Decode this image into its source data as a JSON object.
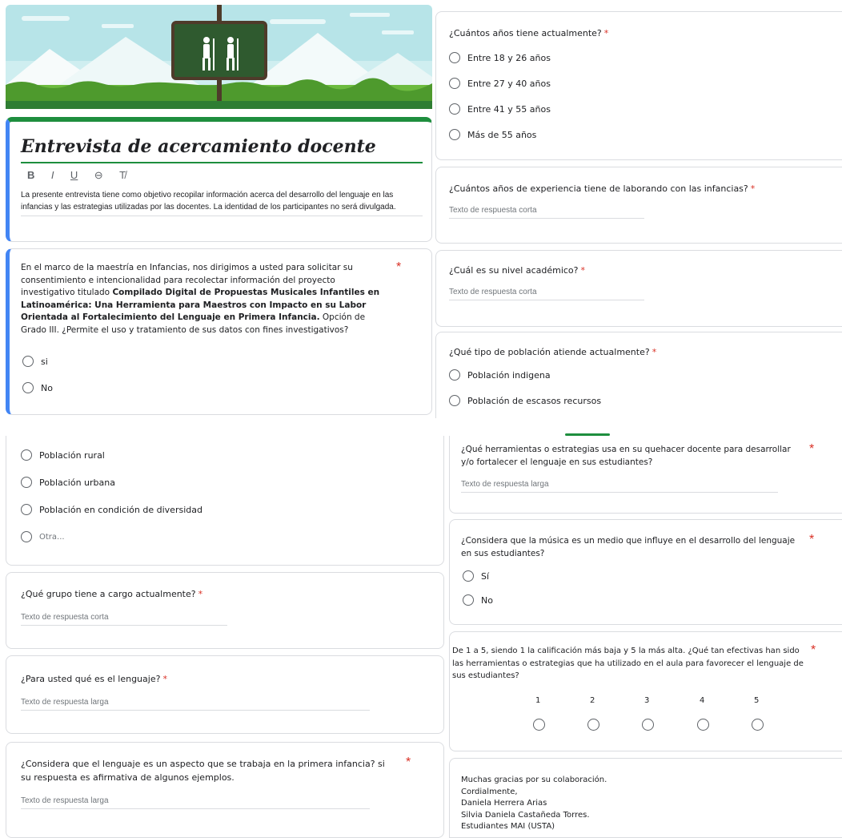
{
  "form": {
    "title": "Entrevista de acercamiento docente",
    "toolbar": {
      "bold": "B",
      "italic": "I",
      "underline": "U",
      "link": "⊖",
      "clear": "T̸"
    },
    "description": "La presente entrevista tiene como objetivo recopilar información acerca del desarrollo del lenguaje en las infancias y las estrategias utilizadas por las docentes. La identidad de los participantes no será divulgada."
  },
  "consent": {
    "text_a": "En el marco de la maestría en Infancias, nos dirigimos a usted para solicitar su consentimiento e intencionalidad para recolectar información del proyecto investigativo titulado ",
    "text_bold": "Compilado Digital de Propuestas Musicales Infantiles en Latinoamérica: Una Herramienta para Maestros con Impacto en su Labor Orientada al Fortalecimiento del Lenguaje en Primera Infancia.",
    "text_b": " Opción de Grado III. ¿Permite el uso y tratamiento de sus datos con fines investigativos?",
    "options": [
      "si",
      "No"
    ]
  },
  "q_age": {
    "label": "¿Cuántos años tiene actualmente?",
    "options": [
      "Entre 18 y 26 años",
      "Entre 27 y 40 años",
      "Entre 41 y 55 años",
      "Más de 55 años"
    ]
  },
  "q_experience": {
    "label": "¿Cuántos años de experiencia tiene de laborando con las infancias?",
    "placeholder": "Texto de respuesta corta"
  },
  "q_level": {
    "label": "¿Cuál es su nivel académico?",
    "placeholder": "Texto de respuesta corta"
  },
  "q_population": {
    "label": "¿Qué tipo de población atiende actualmente?",
    "options": [
      "Población indigena",
      "Población de escasos recursos",
      "Población rural",
      "Población urbana",
      "Población en condición de diversidad",
      "Otra..."
    ]
  },
  "q_group": {
    "label": "¿Qué grupo tiene a cargo actualmente?",
    "placeholder": "Texto de respuesta corta"
  },
  "q_language": {
    "label": "¿Para usted qué es el lenguaje?",
    "placeholder": "Texto de respuesta larga"
  },
  "q_early": {
    "label": "¿Considera que el lenguaje es un aspecto que se trabaja en la primera infancia? si su respuesta es afirmativa de algunos ejemplos.",
    "placeholder": "Texto de respuesta larga"
  },
  "q_tools": {
    "label": "¿Qué herramientas o estrategias usa en su quehacer docente para desarrollar y/o fortalecer el lenguaje en sus estudiantes?",
    "placeholder": "Texto de respuesta larga"
  },
  "q_music": {
    "label": "¿Considera que la música es un medio que influye en el desarrollo del lenguaje en sus estudiantes?",
    "options": [
      "Sí",
      "No"
    ]
  },
  "q_scale": {
    "label": "De 1 a 5, siendo 1 la calificación más baja y 5 la más alta. ¿Qué tan efectivas han sido las herramientas o estrategias que ha utilizado en el aula para favorecer el lenguaje de sus estudiantes?",
    "numbers": [
      "1",
      "2",
      "3",
      "4",
      "5"
    ]
  },
  "thanks": {
    "lines": [
      "Muchas gracias por su colaboración.",
      "Cordialmente,",
      "Daniela Herrera Arias",
      "Silvia Daniela Castañeda Torres.",
      "Estudiantes MAI (USTA)"
    ]
  },
  "required_mark": "*",
  "colors": {
    "accent_blue": "#4285f4",
    "required_red": "#d93025",
    "header_green": "#1e8e3e"
  }
}
